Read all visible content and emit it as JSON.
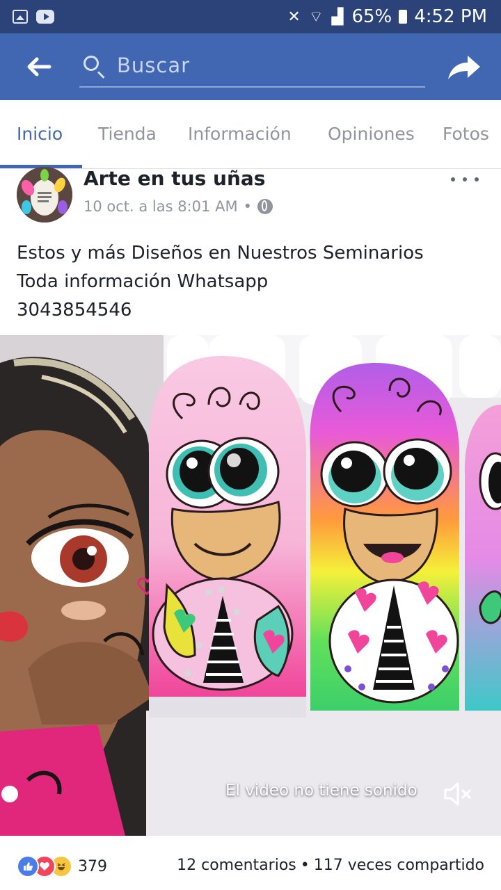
{
  "status_bar": {
    "battery": "65%",
    "time": "4:52 PM",
    "left_icons": [
      "image-icon",
      "youtube-icon"
    ],
    "right_icons": [
      "mute-vibrate-icon",
      "wifi-icon",
      "signal-icon",
      "battery-icon"
    ]
  },
  "toolbar": {
    "search_placeholder": "Buscar",
    "icons": [
      "back-arrow-icon",
      "search-icon",
      "share-icon"
    ]
  },
  "tabs": [
    {
      "label": "Inicio",
      "active": true
    },
    {
      "label": "Tienda",
      "active": false
    },
    {
      "label": "Información",
      "active": false
    },
    {
      "label": "Opiniones",
      "active": false
    },
    {
      "label": "Fotos",
      "active": false
    }
  ],
  "post": {
    "page_name": "Arte en tus uñas",
    "timestamp": "10 oct. a las 8:01 AM",
    "separator": "•",
    "audience_icon": "globe-icon",
    "text_lines": [
      "Estos y más  Diseños en Nuestros Seminarios",
      "Toda información Whatsapp",
      "3043854546"
    ]
  },
  "media": {
    "no_sound_label": "El video no tiene sonido",
    "mute_icon": "speaker-muted-icon"
  },
  "footer": {
    "reaction_icons": [
      "like-icon",
      "love-icon",
      "haha-icon"
    ],
    "reaction_count": "379",
    "comments": "12 comentarios",
    "separator": "•",
    "shares": "117 veces compartido"
  },
  "colors": {
    "facebook_blue": "#4267b2",
    "status_bar": "#2b4378",
    "text_secondary": "#90949c"
  }
}
